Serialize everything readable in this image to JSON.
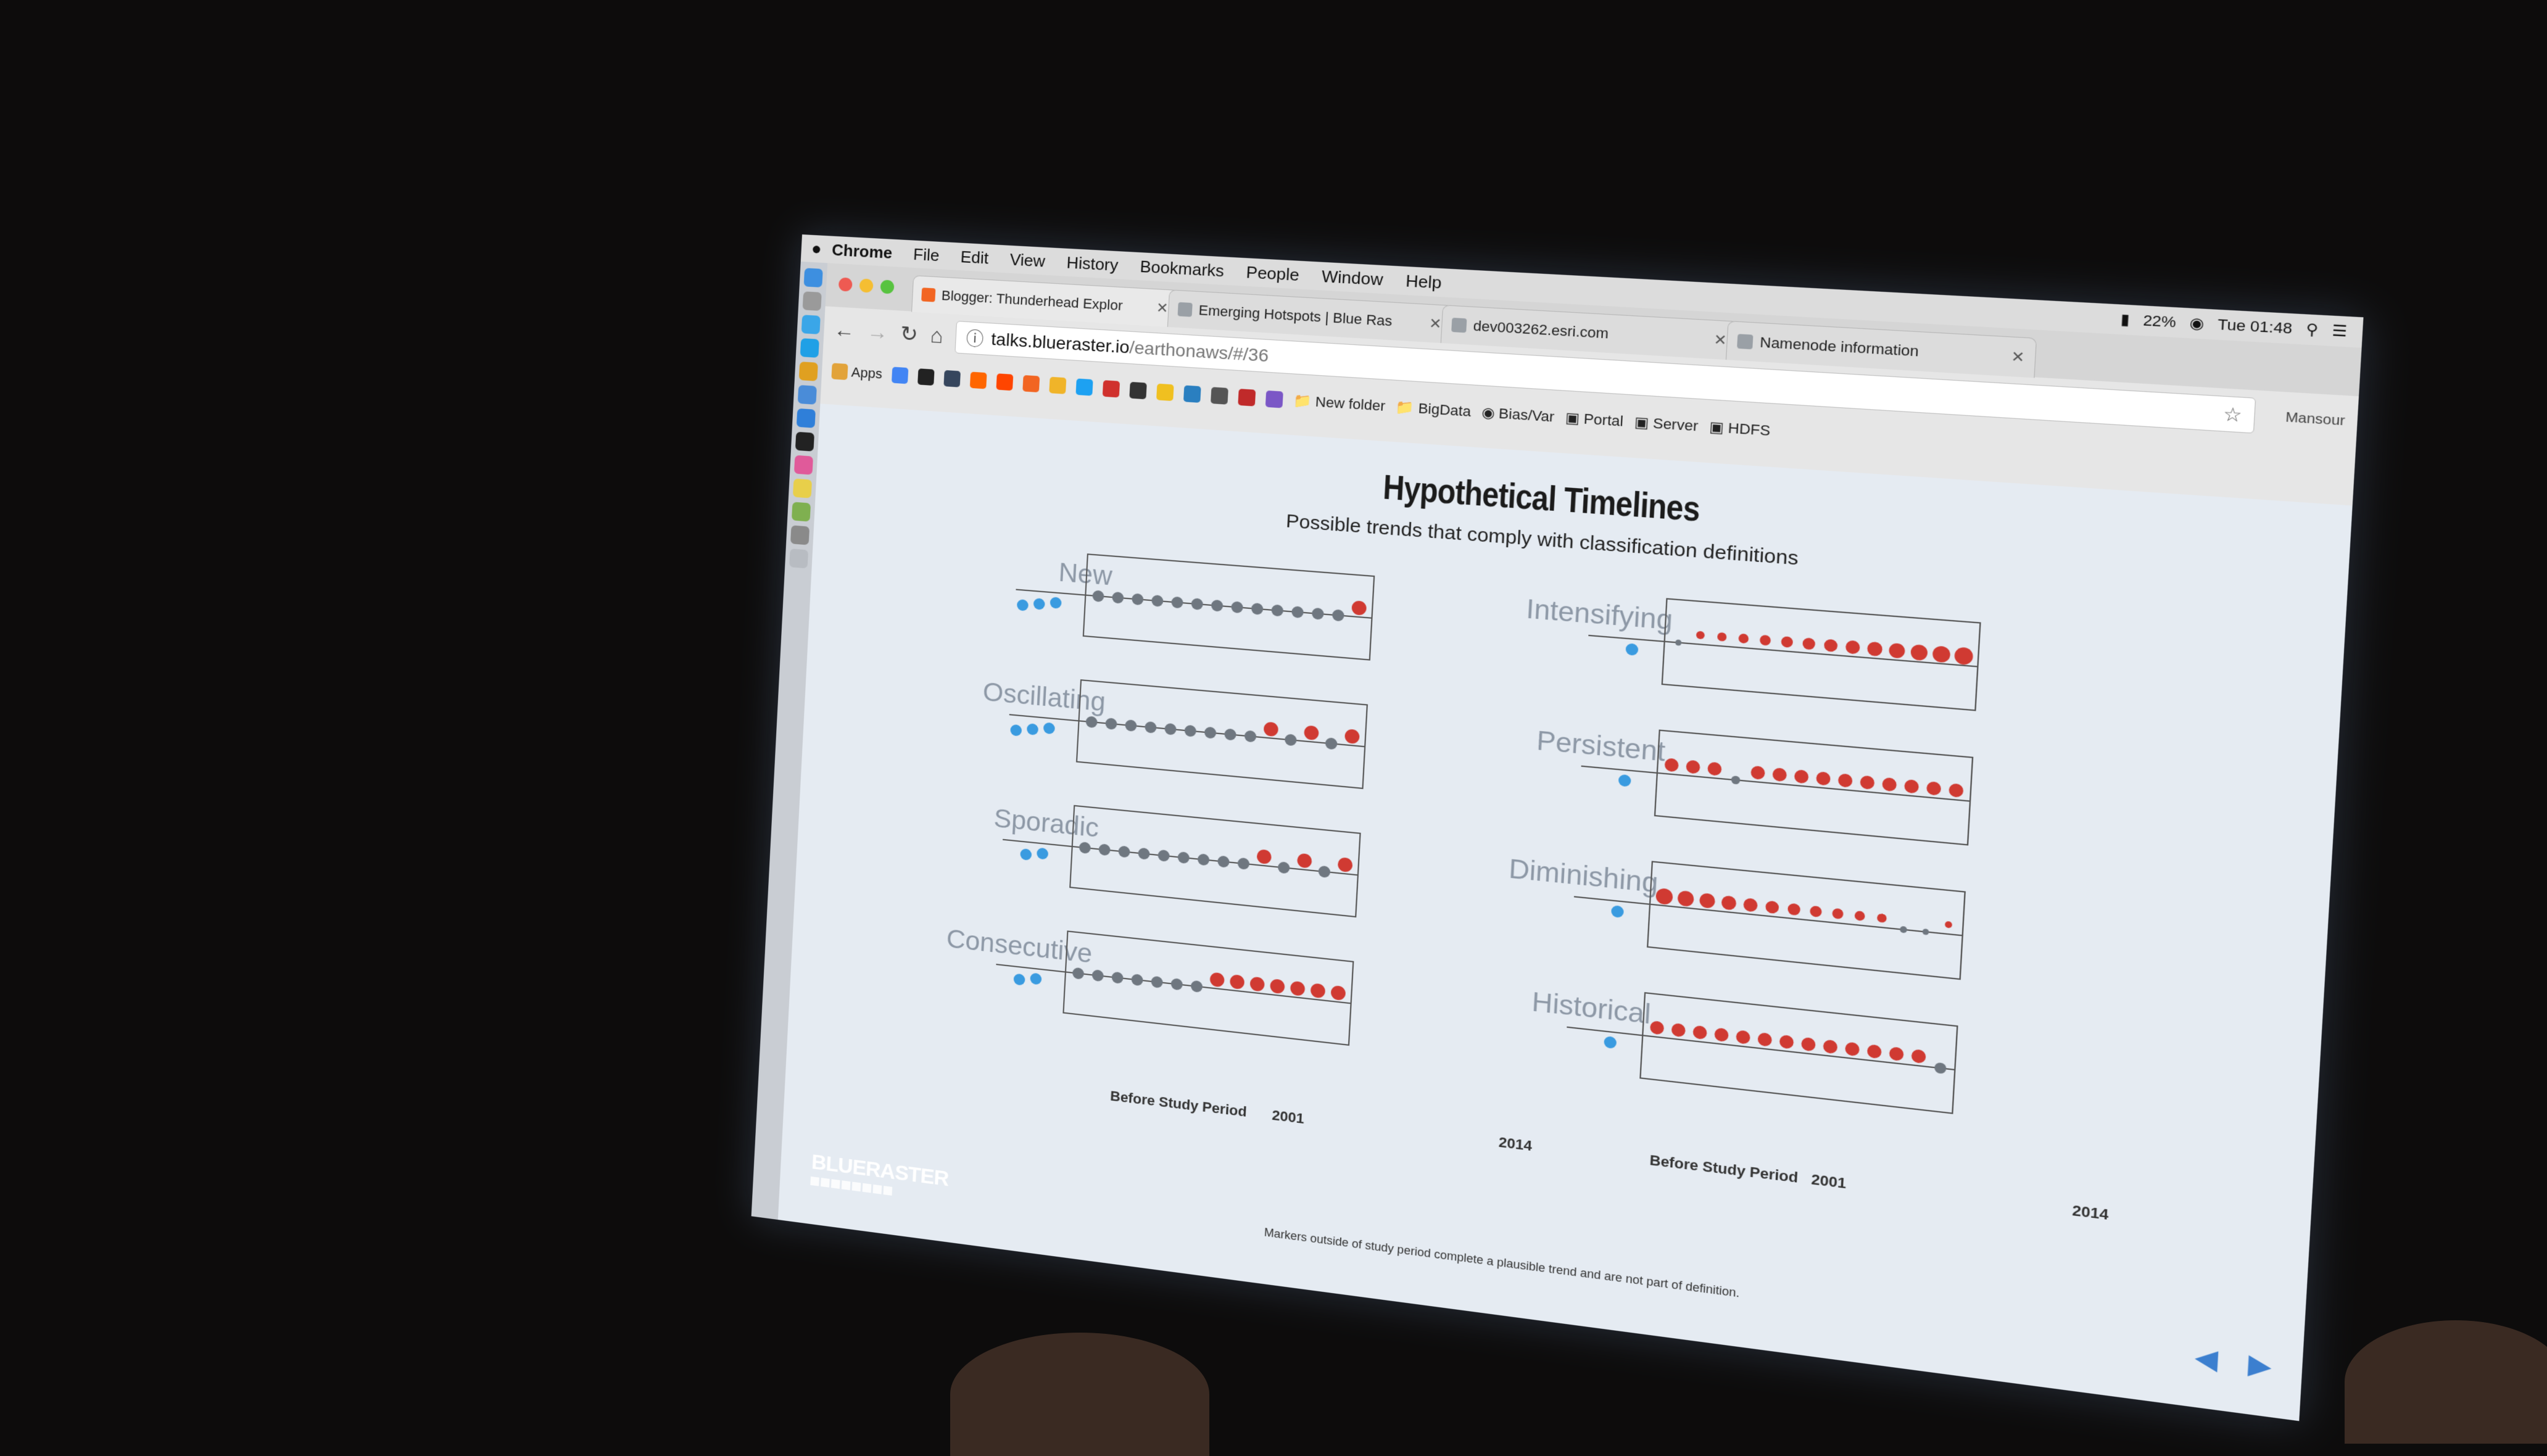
{
  "menubar": {
    "app": "Chrome",
    "items": [
      "File",
      "Edit",
      "View",
      "History",
      "Bookmarks",
      "People",
      "Window",
      "Help"
    ],
    "clock": "Tue 01:48",
    "battery": "22%"
  },
  "tabs": [
    {
      "label": "Blogger: Thunderhead Explor",
      "favicon_color": "#f26522",
      "active": true
    },
    {
      "label": "Emerging Hotspots | Blue Ras",
      "favicon_color": "#9aa0a6",
      "active": false
    },
    {
      "label": "dev003262.esri.com",
      "favicon_color": "#9aa0a6",
      "active": false
    },
    {
      "label": "Namenode information",
      "favicon_color": "#9aa0a6",
      "active": false
    }
  ],
  "toolbar": {
    "url_host": "talks.blueraster.io",
    "url_path": "/earthonaws/#/36",
    "profile": "Mansour"
  },
  "bookmarks": {
    "apps_label": "Apps",
    "folders": [
      "New folder",
      "BigData",
      "Bias/Var",
      "Portal",
      "Server",
      "HDFS"
    ]
  },
  "slide": {
    "title": "Hypothetical Timelines",
    "subtitle": "Possible trends that comply with classification definitions",
    "footnote": "Markers outside of study period complete a plausible trend and are not part of definition.",
    "axis_before": "Before Study Period",
    "axis_start": "2001",
    "axis_end": "2014",
    "logo": "BLUERASTER",
    "colors": {
      "before": "#3a9be0",
      "cold": "#6f7780",
      "hot": "#d03a32"
    }
  },
  "chart_data": [
    {
      "type": "scatter",
      "title": "New",
      "before": [
        1,
        1,
        1
      ],
      "study": [
        "c",
        "c",
        "c",
        "c",
        "c",
        "c",
        "c",
        "c",
        "c",
        "c",
        "c",
        "c",
        "c",
        "h"
      ],
      "sizes": [
        1,
        1,
        1,
        1,
        1,
        1,
        1,
        1,
        1,
        1,
        1,
        1,
        1,
        1
      ]
    },
    {
      "type": "scatter",
      "title": "Oscillating",
      "before": [
        1,
        1,
        1
      ],
      "study": [
        "c",
        "c",
        "c",
        "c",
        "c",
        "c",
        "c",
        "c",
        "c",
        "h",
        "c",
        "h",
        "c",
        "h"
      ],
      "sizes": [
        1,
        1,
        1,
        1,
        1,
        1,
        1,
        1,
        1,
        1,
        1,
        1,
        1,
        1
      ]
    },
    {
      "type": "scatter",
      "title": "Sporadic",
      "before": [
        1,
        1
      ],
      "study": [
        "c",
        "c",
        "c",
        "c",
        "c",
        "c",
        "c",
        "c",
        "c",
        "h",
        "c",
        "h",
        "c",
        "h"
      ],
      "sizes": [
        1,
        1,
        1,
        1,
        1,
        1,
        1,
        1,
        1,
        1,
        1,
        1,
        1,
        1
      ]
    },
    {
      "type": "scatter",
      "title": "Consecutive",
      "before": [
        1,
        1
      ],
      "study": [
        "c",
        "c",
        "c",
        "c",
        "c",
        "c",
        "c",
        "h",
        "h",
        "h",
        "h",
        "h",
        "h",
        "h"
      ],
      "sizes": [
        1,
        1,
        1,
        1,
        1,
        1,
        1,
        1,
        1,
        1,
        1,
        1,
        1,
        1
      ]
    },
    {
      "type": "scatter",
      "title": "Intensifying",
      "before": [
        1
      ],
      "study": [
        "c",
        "h",
        "h",
        "h",
        "h",
        "h",
        "h",
        "h",
        "h",
        "h",
        "h",
        "h",
        "h",
        "h"
      ],
      "sizes": [
        0.5,
        0.55,
        0.6,
        0.65,
        0.7,
        0.75,
        0.8,
        0.85,
        0.9,
        0.95,
        1,
        1.05,
        1.1,
        1.15
      ]
    },
    {
      "type": "scatter",
      "title": "Persistent",
      "before": [
        1
      ],
      "study": [
        "h",
        "h",
        "h",
        "c",
        "h",
        "h",
        "h",
        "h",
        "h",
        "h",
        "h",
        "h",
        "h",
        "h"
      ],
      "sizes": [
        0.9,
        0.9,
        0.9,
        0.7,
        0.9,
        0.9,
        0.9,
        0.9,
        0.9,
        0.9,
        0.9,
        0.9,
        0.9,
        0.9
      ]
    },
    {
      "type": "scatter",
      "title": "Diminishing",
      "before": [
        1
      ],
      "study": [
        "h",
        "h",
        "h",
        "h",
        "h",
        "h",
        "h",
        "h",
        "h",
        "h",
        "h",
        "c",
        "c",
        "h"
      ],
      "sizes": [
        1.1,
        1.05,
        1,
        0.95,
        0.9,
        0.85,
        0.8,
        0.75,
        0.7,
        0.65,
        0.6,
        0.55,
        0.5,
        0.45
      ]
    },
    {
      "type": "scatter",
      "title": "Historical",
      "before": [
        1
      ],
      "study": [
        "h",
        "h",
        "h",
        "h",
        "h",
        "h",
        "h",
        "h",
        "h",
        "h",
        "h",
        "h",
        "h",
        "c"
      ],
      "sizes": [
        0.9,
        0.9,
        0.9,
        0.9,
        0.9,
        0.9,
        0.9,
        0.9,
        0.9,
        0.9,
        0.9,
        0.9,
        0.9,
        0.9
      ]
    }
  ]
}
